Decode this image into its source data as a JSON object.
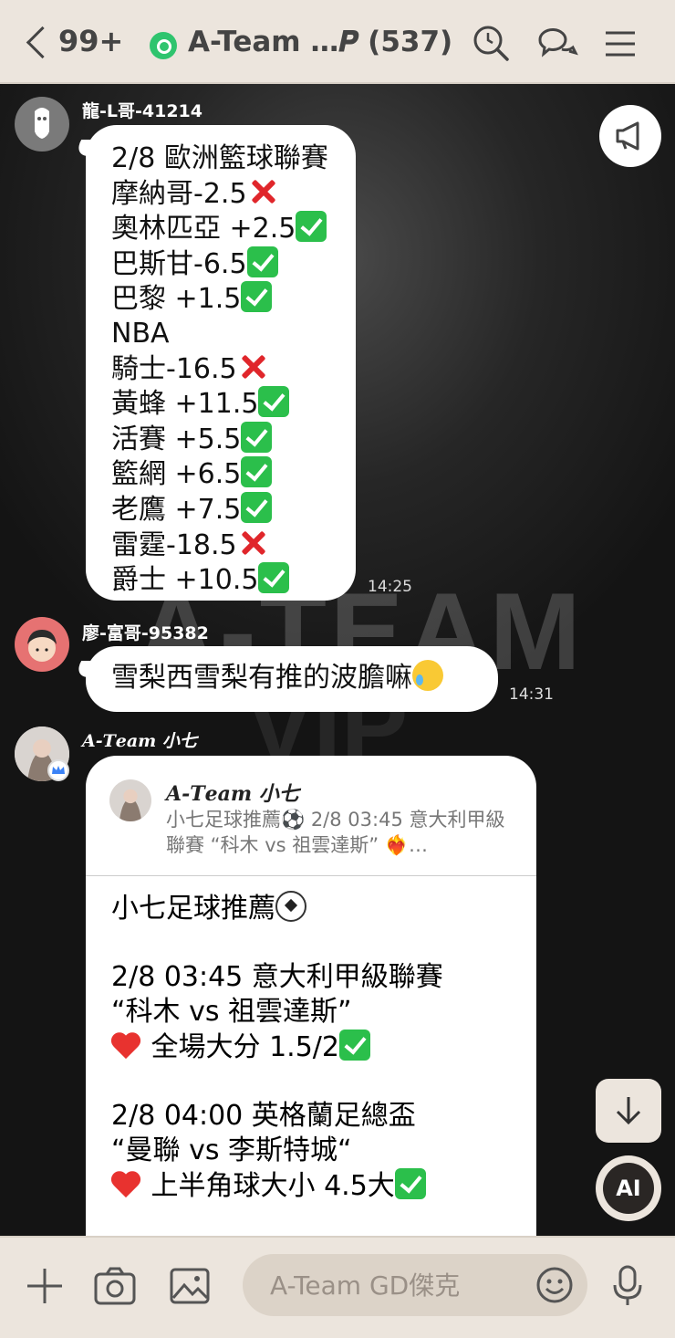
{
  "header": {
    "unread_count": "99+",
    "title": "A-Team …𝑷 (537)"
  },
  "messages": {
    "m1": {
      "sender": "龍-L哥-41214",
      "time": "14:25",
      "lines": [
        {
          "text": "2/8 歐洲籃球聯賽",
          "mark": ""
        },
        {
          "text": "摩納哥-2.5",
          "mark": "cross"
        },
        {
          "text": "奧林匹亞 +2.5",
          "mark": "check"
        },
        {
          "text": "巴斯甘-6.5",
          "mark": "check"
        },
        {
          "text": "巴黎 +1.5",
          "mark": "check"
        },
        {
          "text": "NBA",
          "mark": ""
        },
        {
          "text": "騎士-16.5",
          "mark": "cross"
        },
        {
          "text": "黃蜂 +11.5",
          "mark": "check"
        },
        {
          "text": "活賽 +5.5",
          "mark": "check"
        },
        {
          "text": "籃網 +6.5",
          "mark": "check"
        },
        {
          "text": "老鷹 +7.5",
          "mark": "check"
        },
        {
          "text": "雷霆-18.5",
          "mark": "cross"
        },
        {
          "text": "爵士 +10.5",
          "mark": "check"
        }
      ]
    },
    "m2": {
      "sender": "廖-富哥-95382",
      "time": "14:31",
      "text": "雪梨西雪梨有推的波膽嘛"
    },
    "m3": {
      "sender": "𝑨-𝑻𝒆𝒂𝒎 小七",
      "quote_author": "𝑨-𝑻𝒆𝒂𝒎 小七",
      "quote_snippet": "小七足球推薦⚽ 2/8 03:45 意大利甲級聯賽 “科木 vs 祖雲達斯” ❤️‍🔥…",
      "body": {
        "l1": "小七足球推薦",
        "l2": "2/8 03:45 意大利甲級聯賽",
        "l3": "“科木 vs 祖雲達斯”",
        "l4": "全場大分 1.5/2",
        "l5": "2/8 04:00 英格蘭足總盃",
        "l6": "“曼聯 vs 李斯特城“",
        "l7": "上半角球大小 4.5大"
      }
    }
  },
  "watermark": {
    "line1": "A-TEAM",
    "line2": "VIP"
  },
  "ai_label": "AI",
  "input": {
    "placeholder": "A-Team GD傑克"
  },
  "colors": {
    "header_bg": "#ece5dd",
    "check": "#2bbf4b",
    "cross": "#e0262b",
    "group_icon": "#2fc46e"
  }
}
